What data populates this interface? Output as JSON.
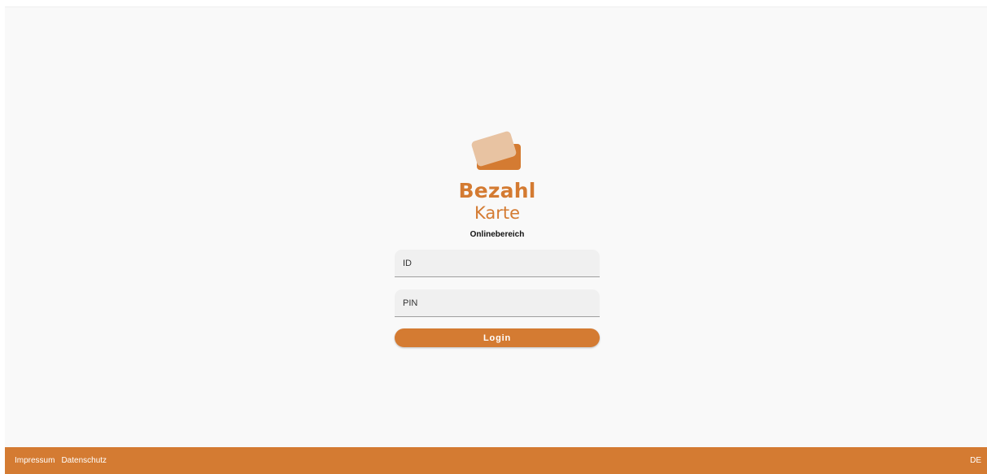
{
  "brand": {
    "line1": "Bezahl",
    "line2": "Karte",
    "logo_icon": "payment-card-icon",
    "subtitle": "Onlinebereich",
    "color": "#d47b32"
  },
  "form": {
    "id_placeholder": "ID",
    "id_value": "",
    "pin_placeholder": "PIN",
    "pin_value": "",
    "login_label": "Login"
  },
  "footer": {
    "impressum": "Impressum",
    "datenschutz": "Datenschutz",
    "language": "DE",
    "background": "#d47b32"
  }
}
